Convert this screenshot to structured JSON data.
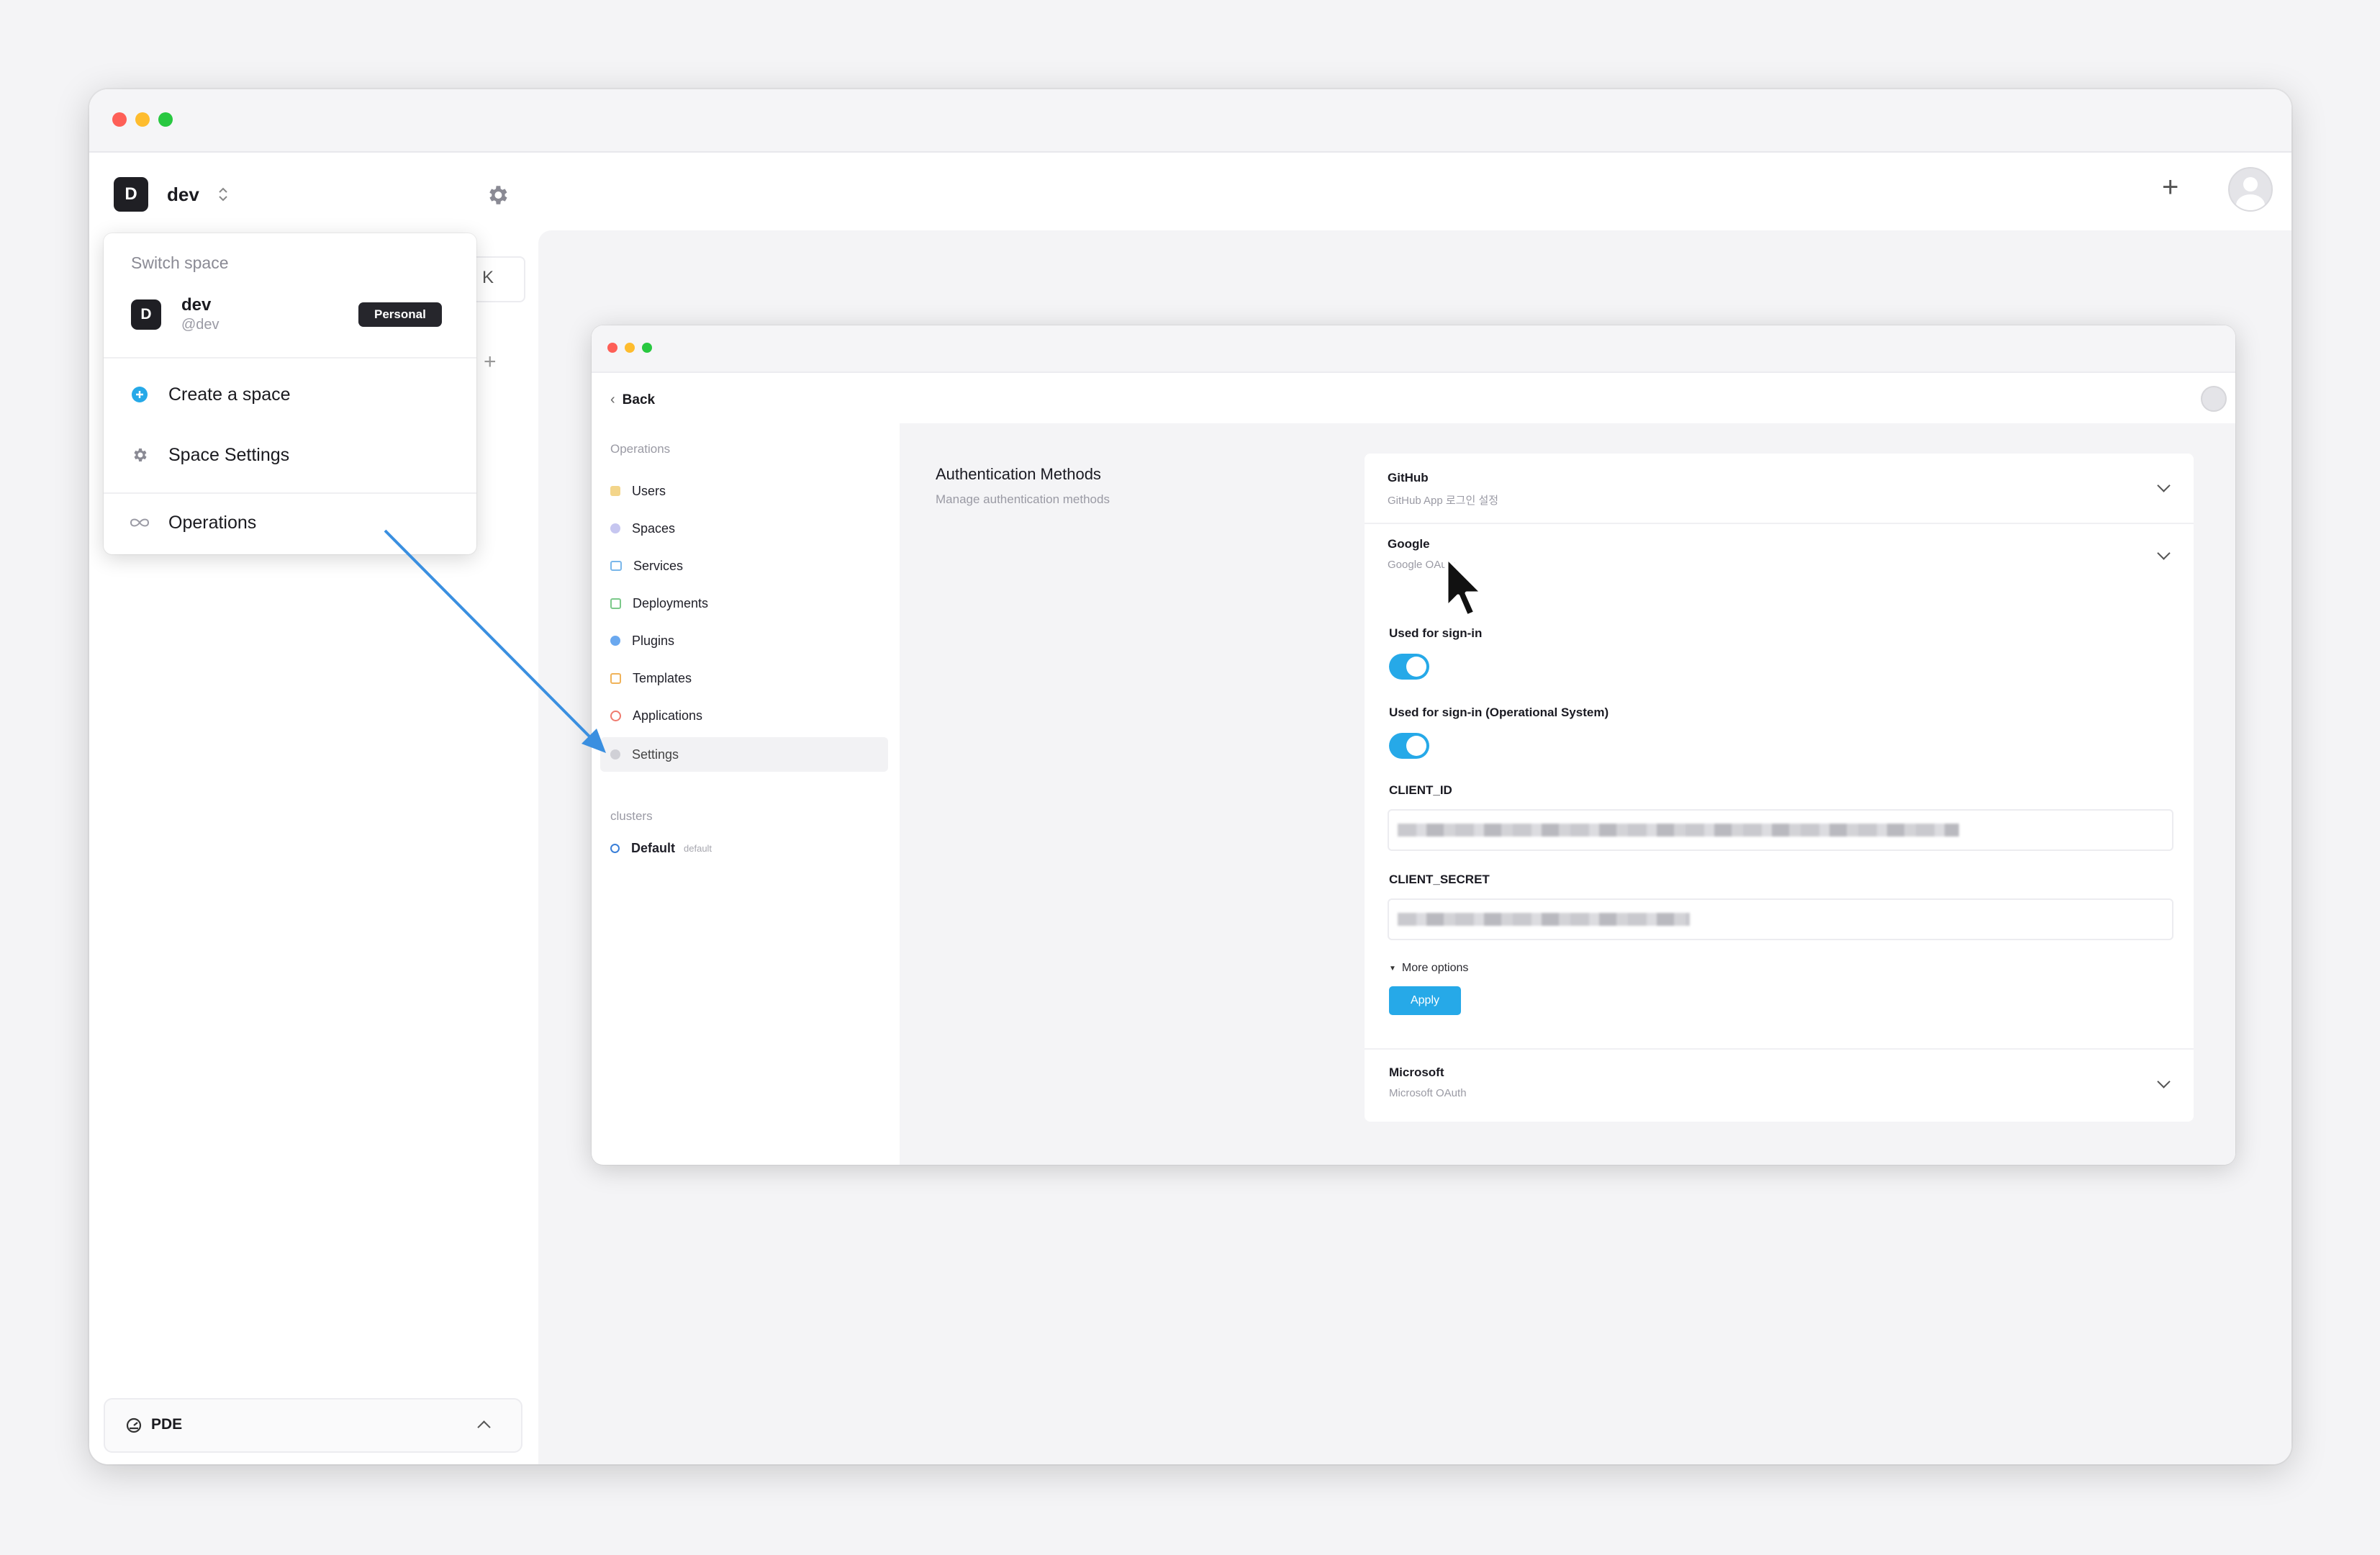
{
  "sidebar": {
    "space_initial": "D",
    "space_name": "dev",
    "footer_label": "PDE",
    "partial_key": "K"
  },
  "dropdown": {
    "header": "Switch space",
    "space": {
      "initial": "D",
      "name": "dev",
      "handle": "@dev",
      "badge": "Personal"
    },
    "items": [
      {
        "label": "Create a space",
        "icon": "plus-circle-icon"
      },
      {
        "label": "Space Settings",
        "icon": "gear-icon"
      },
      {
        "label": "Operations",
        "icon": "infinity-icon"
      }
    ]
  },
  "inner": {
    "back_label": "Back",
    "operations_header": "Operations",
    "nav": [
      "Users",
      "Spaces",
      "Services",
      "Deployments",
      "Plugins",
      "Templates",
      "Applications",
      "Settings"
    ],
    "clusters_header": "clusters",
    "cluster": {
      "name": "Default",
      "tag": "default"
    },
    "section_title": "Authentication Methods",
    "section_sub": "Manage authentication methods",
    "providers": {
      "github": {
        "title": "GitHub",
        "sub": "GitHub App 로그인 설정"
      },
      "google": {
        "title": "Google",
        "sub": "Google OAuth"
      },
      "microsoft": {
        "title": "Microsoft",
        "sub": "Microsoft OAuth"
      }
    },
    "toggle1_label": "Used for sign-in",
    "toggle2_label": "Used for sign-in (Operational System)",
    "client_id_label": "CLIENT_ID",
    "client_secret_label": "CLIENT_SECRET",
    "more_options": "More options",
    "apply": "Apply"
  },
  "colors": {
    "accent": "#26a9e8",
    "arrow": "#3a8fe0",
    "dark": "#1f1f24"
  }
}
